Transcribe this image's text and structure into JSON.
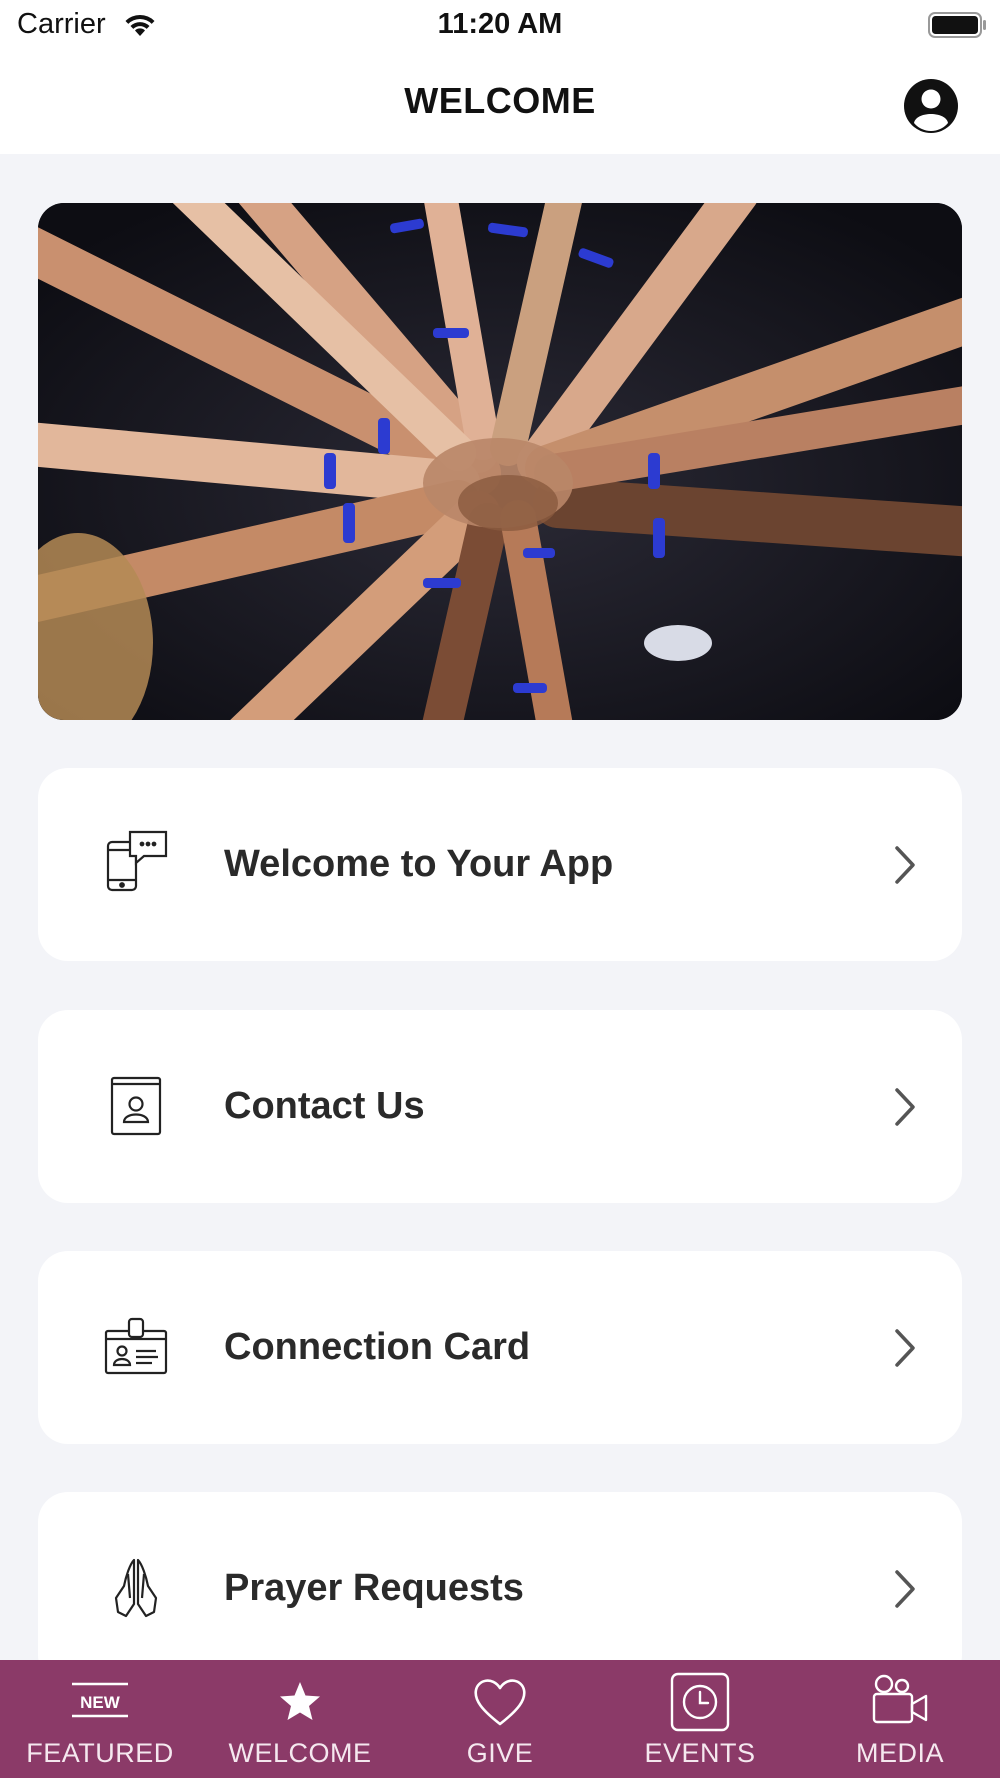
{
  "status_bar": {
    "carrier": "Carrier",
    "time": "11:20 AM"
  },
  "header": {
    "title": "WELCOME",
    "profile_icon": "user-circle-icon"
  },
  "hero": {
    "image": "hands-together-photo"
  },
  "menu": {
    "items": [
      {
        "label": "Welcome to Your App",
        "icon": "phone-chat-icon"
      },
      {
        "label": "Contact Us",
        "icon": "contact-book-icon"
      },
      {
        "label": "Connection Card",
        "icon": "id-badge-icon"
      },
      {
        "label": "Prayer Requests",
        "icon": "praying-hands-icon"
      }
    ]
  },
  "tab_bar": {
    "background": "#8b3a68",
    "tabs": [
      {
        "label": "FEATURED",
        "icon": "new-badge-icon",
        "badge_text": "NEW"
      },
      {
        "label": "WELCOME",
        "icon": "star-icon"
      },
      {
        "label": "GIVE",
        "icon": "heart-icon"
      },
      {
        "label": "EVENTS",
        "icon": "clock-icon"
      },
      {
        "label": "MEDIA",
        "icon": "video-camera-icon"
      }
    ]
  }
}
